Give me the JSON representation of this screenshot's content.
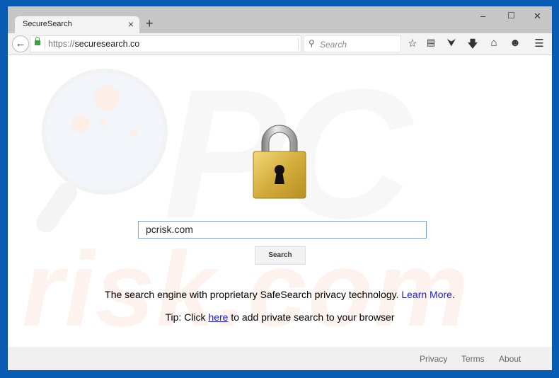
{
  "browser": {
    "tab": {
      "title": "SecureSearch",
      "close_icon": "×"
    },
    "new_tab_icon": "+",
    "window_controls": {
      "minimize": "–",
      "maximize": "☐",
      "close": "✕"
    },
    "url": {
      "protocol": "https://",
      "host": "securesearch.co"
    },
    "search_placeholder": "Search",
    "toolbar_icons": [
      "star-icon",
      "reading-list-icon",
      "pocket-icon",
      "download-icon",
      "home-icon",
      "chat-icon",
      "menu-icon"
    ]
  },
  "page": {
    "query_value": "pcrisk.com",
    "search_button": "Search",
    "tagline": "The search engine with proprietary SafeSearch privacy technology.",
    "learn_more": "Learn More",
    "tagline_end": ".",
    "tip_prefix": "Tip: Click ",
    "tip_link": "here",
    "tip_suffix": " to add private search to your browser",
    "watermark_top": "PC",
    "watermark_bottom": "risk.com"
  },
  "footer": {
    "links": [
      "Privacy",
      "Terms",
      "About"
    ]
  },
  "colors": {
    "frame": "#0a5bb4",
    "link": "#2222bb",
    "lock": "#3aa63a"
  }
}
